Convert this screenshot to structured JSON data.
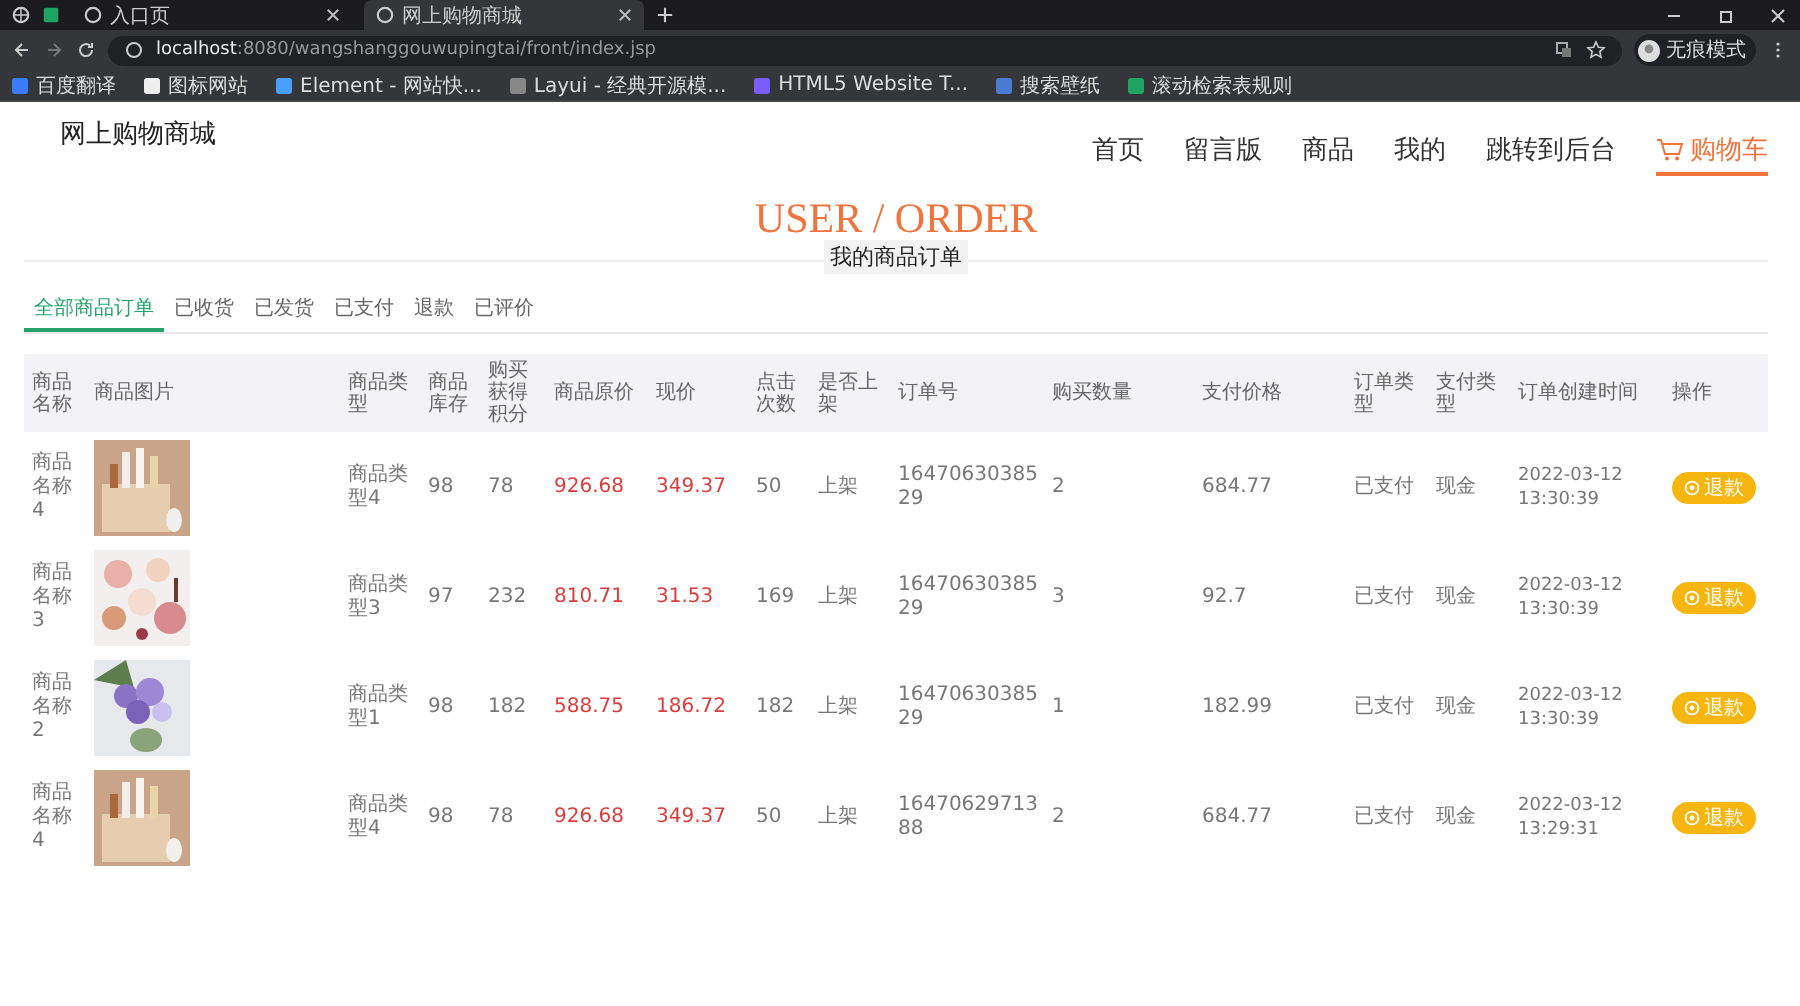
{
  "browser": {
    "tabs": [
      {
        "title": "入口页",
        "selected": false
      },
      {
        "title": "网上购物商城",
        "selected": true
      }
    ],
    "url_host": "localhost",
    "url_rest": ":8080/wangshanggouwupingtai/front/index.jsp",
    "profile": "无痕模式",
    "bookmarks": [
      "百度翻译",
      "图标网站",
      "Element - 网站快...",
      "Layui - 经典开源模...",
      "HTML5 Website T...",
      "搜索壁纸",
      "滚动检索表规则"
    ]
  },
  "site": {
    "logo": "网上购物商城",
    "nav": [
      {
        "label": "首页",
        "selected": false,
        "kind": "link"
      },
      {
        "label": "留言版",
        "selected": false,
        "kind": "link"
      },
      {
        "label": "商品",
        "selected": false,
        "kind": "link"
      },
      {
        "label": "我的",
        "selected": false,
        "kind": "link"
      },
      {
        "label": "跳转到后台",
        "selected": false,
        "kind": "link"
      },
      {
        "label": "购物车",
        "selected": true,
        "kind": "cart"
      }
    ]
  },
  "heading": {
    "title": "USER / ORDER",
    "subtitle": "我的商品订单"
  },
  "order_tabs": [
    {
      "label": "全部商品订单",
      "selected": true
    },
    {
      "label": "已收货",
      "selected": false
    },
    {
      "label": "已发货",
      "selected": false
    },
    {
      "label": "已支付",
      "selected": false
    },
    {
      "label": "退款",
      "selected": false
    },
    {
      "label": "已评价",
      "selected": false
    }
  ],
  "table": {
    "columns": [
      "商品名称",
      "商品图片",
      "商品类型",
      "商品库存",
      "购买获得积分",
      "商品原价",
      "现价",
      "点击次数",
      "是否上架",
      "订单号",
      "购买数量",
      "支付价格",
      "订单类型",
      "支付类型",
      "订单创建时间",
      "操作"
    ],
    "rows": [
      {
        "name": "商品名称4",
        "type": "商品类型4",
        "stock": "98",
        "points": "78",
        "original_price": "926.68",
        "price": "349.37",
        "clicks": "50",
        "on_shelf": "上架",
        "order_no": "1647063038529",
        "quantity": "2",
        "paid": "684.77",
        "order_type": "已支付",
        "pay_type": "现金",
        "created": "2022-03-12 13:30:39",
        "action": "退款"
      },
      {
        "name": "商品名称3",
        "type": "商品类型3",
        "stock": "97",
        "points": "232",
        "original_price": "810.71",
        "price": "31.53",
        "clicks": "169",
        "on_shelf": "上架",
        "order_no": "1647063038529",
        "quantity": "3",
        "paid": "92.7",
        "order_type": "已支付",
        "pay_type": "现金",
        "created": "2022-03-12 13:30:39",
        "action": "退款"
      },
      {
        "name": "商品名称2",
        "type": "商品类型1",
        "stock": "98",
        "points": "182",
        "original_price": "588.75",
        "price": "186.72",
        "clicks": "182",
        "on_shelf": "上架",
        "order_no": "1647063038529",
        "quantity": "1",
        "paid": "182.99",
        "order_type": "已支付",
        "pay_type": "现金",
        "created": "2022-03-12 13:30:39",
        "action": "退款"
      },
      {
        "name": "商品名称4",
        "type": "商品类型4",
        "stock": "98",
        "points": "78",
        "original_price": "926.68",
        "price": "349.37",
        "clicks": "50",
        "on_shelf": "上架",
        "order_no": "1647062971388",
        "quantity": "2",
        "paid": "684.77",
        "order_type": "已支付",
        "pay_type": "现金",
        "created": "2022-03-12 13:29:31",
        "action": "退款"
      }
    ]
  }
}
